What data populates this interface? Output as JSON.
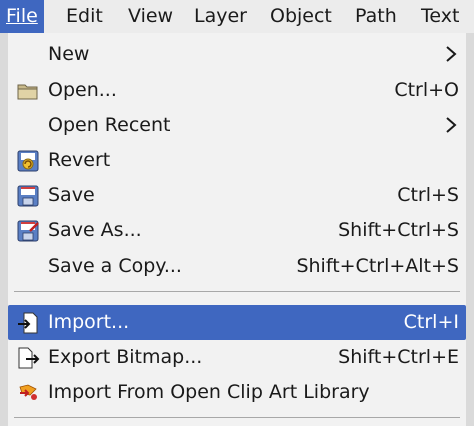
{
  "menubar": {
    "items": [
      {
        "label": "File",
        "active": true
      },
      {
        "label": "Edit"
      },
      {
        "label": "View"
      },
      {
        "label": "Layer"
      },
      {
        "label": "Object"
      },
      {
        "label": "Path"
      },
      {
        "label": "Text"
      }
    ]
  },
  "file_menu": {
    "items": [
      {
        "label": "New",
        "shortcut": "",
        "submenu": true,
        "icon": "none"
      },
      {
        "label": "Open...",
        "shortcut": "Ctrl+O",
        "icon": "folder-icon"
      },
      {
        "label": "Open Recent",
        "shortcut": "",
        "submenu": true,
        "icon": "none"
      },
      {
        "label": "Revert",
        "shortcut": "",
        "icon": "revert-icon"
      },
      {
        "label": "Save",
        "shortcut": "Ctrl+S",
        "icon": "save-icon"
      },
      {
        "label": "Save As...",
        "shortcut": "Shift+Ctrl+S",
        "icon": "save-as-icon"
      },
      {
        "label": "Save a Copy...",
        "shortcut": "Shift+Ctrl+Alt+S",
        "icon": "none"
      },
      {
        "label": "Import...",
        "shortcut": "Ctrl+I",
        "icon": "import-icon",
        "highlighted": true
      },
      {
        "label": "Export Bitmap...",
        "shortcut": "Shift+Ctrl+E",
        "icon": "export-icon"
      },
      {
        "label": "Import From Open Clip Art Library",
        "shortcut": "",
        "icon": "clipart-icon"
      }
    ]
  },
  "colors": {
    "highlight": "#3f67c0",
    "menu_background": "#f2f2f2"
  }
}
